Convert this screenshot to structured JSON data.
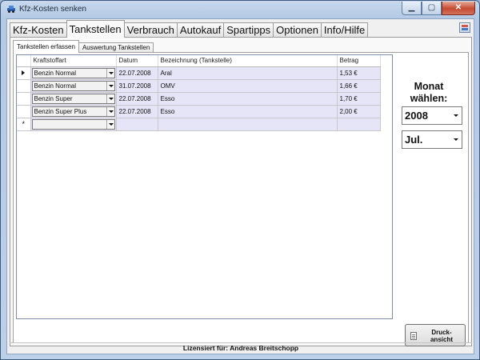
{
  "window": {
    "title": "Kfz-Kosten senken"
  },
  "main_tabs": [
    {
      "label": "Kfz-Kosten",
      "active": false
    },
    {
      "label": "Tankstellen",
      "active": true
    },
    {
      "label": "Verbrauch",
      "active": false
    },
    {
      "label": "Autokauf",
      "active": false
    },
    {
      "label": "Spartipps",
      "active": false
    },
    {
      "label": "Optionen",
      "active": false
    },
    {
      "label": "Info/Hilfe",
      "active": false
    }
  ],
  "sub_tabs": [
    {
      "label": "Tankstellen erfassen",
      "active": true
    },
    {
      "label": "Auswertung Tankstellen",
      "active": false
    }
  ],
  "grid": {
    "columns": [
      "Kraftstoffart",
      "Datum",
      "Bezeichnung (Tankstelle)",
      "Betrag"
    ],
    "rows": [
      {
        "indicator": "current",
        "fuel": "Benzin Normal",
        "date": "22.07.2008",
        "station": "Aral",
        "amount": "1,53 €"
      },
      {
        "indicator": "",
        "fuel": "Benzin Normal",
        "date": "31.07.2008",
        "station": "OMV",
        "amount": "1,66 €"
      },
      {
        "indicator": "",
        "fuel": "Benzin Super",
        "date": "22.07.2008",
        "station": "Esso",
        "amount": "1,70 €"
      },
      {
        "indicator": "",
        "fuel": "Benzin Super Plus",
        "date": "22.07.2008",
        "station": "Esso",
        "amount": "2,00 €"
      }
    ],
    "new_row_indicator": "*"
  },
  "month_picker": {
    "label": "Monat\nwählen:",
    "year": "2008",
    "month": "Jul."
  },
  "print_button": {
    "label": "Druck-\nansicht"
  },
  "status_bar": {
    "text": "Lizensiert für: Andreas Breitschopp"
  }
}
